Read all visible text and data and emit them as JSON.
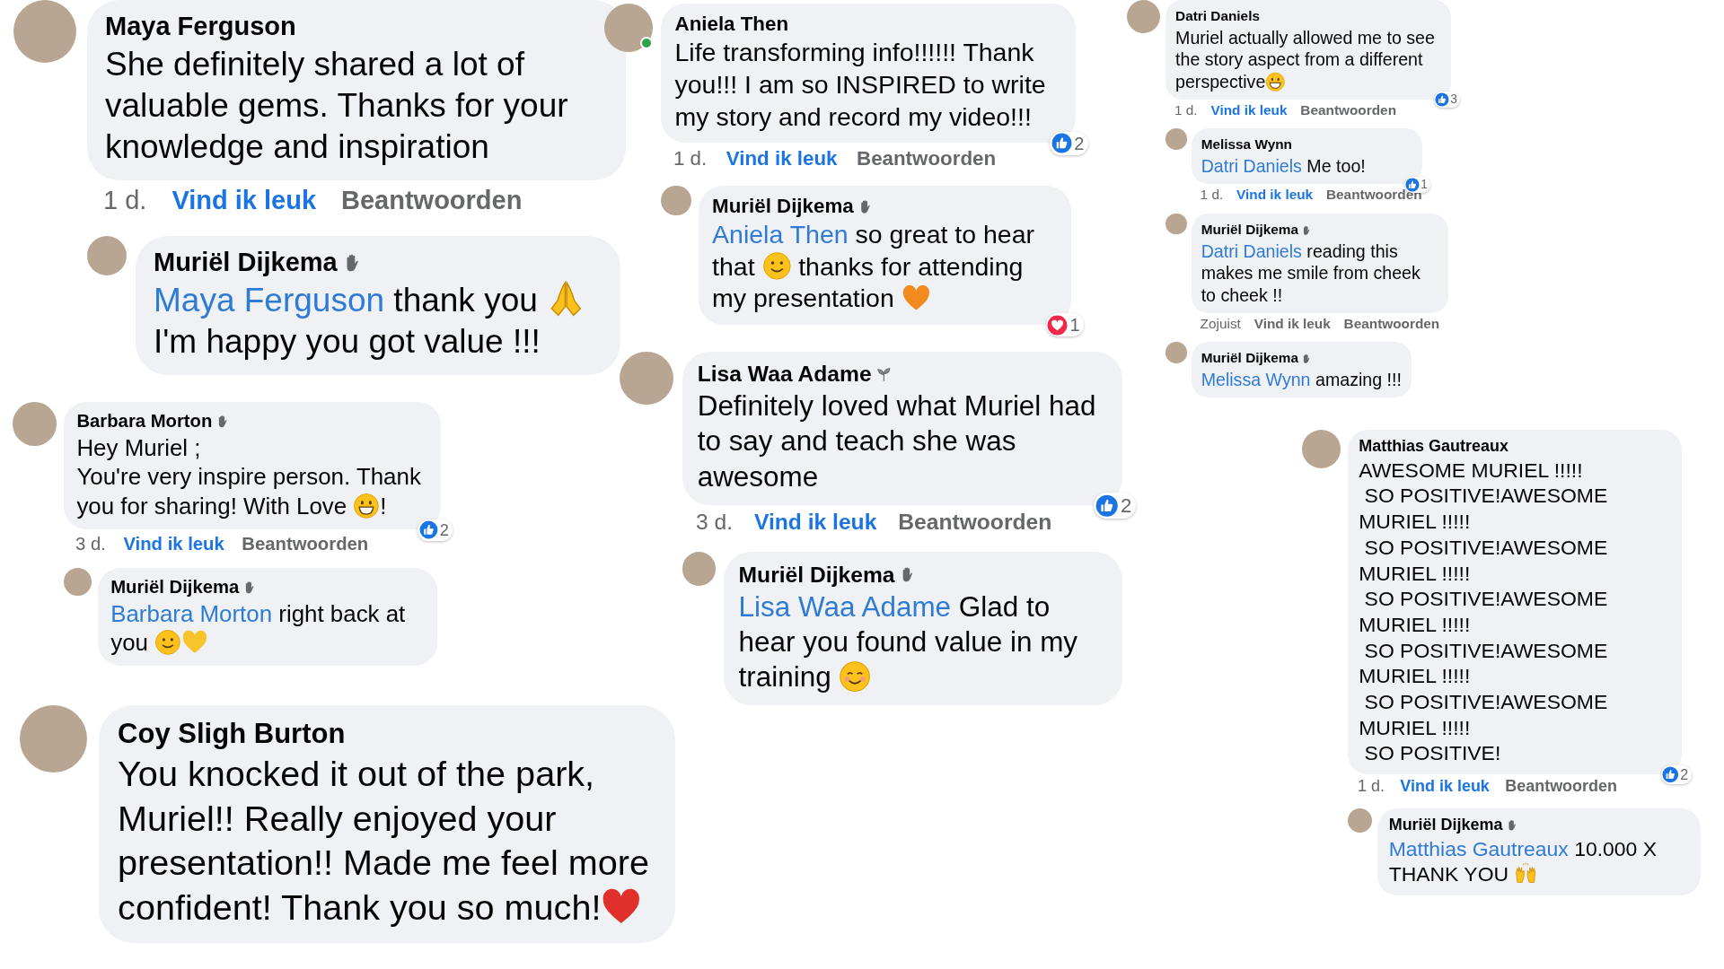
{
  "panels": [
    {
      "comments": [
        {
          "author": "Maya Ferguson",
          "body": [
            {
              "kind": "text",
              "text": "She definitely shared a lot of valuable gems. Thanks for your knowledge and inspiration"
            }
          ],
          "time": "1 d.",
          "like_label": "Vind ik leuk",
          "liked": true,
          "reply_label": "Beantwoorden",
          "replies": [
            {
              "author": "Muriël Dijkema",
              "author_badge": {
                "kind": "wave"
              },
              "body": [
                {
                  "kind": "mention",
                  "text": "Maya Ferguson"
                },
                {
                  "kind": "text",
                  "text": " thank you "
                },
                {
                  "kind": "pray"
                },
                {
                  "kind": "text",
                  "text": " I'm happy you got value !!!"
                }
              ]
            }
          ]
        },
        {
          "author": "Barbara Morton",
          "author_badge": {
            "kind": "wave"
          },
          "body": [
            {
              "kind": "text",
              "text": "Hey Muriel ;\nYou're very inspire person. Thank you for sharing! With Love "
            },
            {
              "kind": "grin"
            },
            {
              "kind": "text",
              "text": "!"
            }
          ],
          "time": "3 d.",
          "like_label": "Vind ik leuk",
          "liked": true,
          "reply_label": "Beantwoorden",
          "reaction": {
            "kind": "like",
            "count": "2"
          },
          "replies": [
            {
              "author": "Muriël Dijkema",
              "author_badge": {
                "kind": "wave"
              },
              "body": [
                {
                  "kind": "mention",
                  "text": "Barbara Morton"
                },
                {
                  "kind": "text",
                  "text": " right back at you "
                },
                {
                  "kind": "smile"
                },
                {
                  "kind": "heart",
                  "color": "#f7c42b"
                }
              ]
            }
          ]
        },
        {
          "author": "Coy Sligh Burton",
          "body": [
            {
              "kind": "text",
              "text": "You knocked it out of the park, Muriel!! Really enjoyed your presentation!! Made me feel more confident! Thank you so much!"
            },
            {
              "kind": "heart",
              "color": "#e0302c"
            }
          ]
        }
      ]
    },
    {
      "comments": [
        {
          "author": "Aniela Then",
          "online": true,
          "body": [
            {
              "kind": "text",
              "text": "Life transforming info!!!!!! Thank you!!! I am so INSPIRED to write my story and record my video!!!"
            }
          ],
          "time": "1 d.",
          "like_label": "Vind ik leuk",
          "liked": true,
          "reply_label": "Beantwoorden",
          "reaction": {
            "kind": "like",
            "count": "2"
          },
          "replies": [
            {
              "author": "Muriël Dijkema",
              "author_badge": {
                "kind": "wave"
              },
              "body": [
                {
                  "kind": "mention",
                  "text": "Aniela Then"
                },
                {
                  "kind": "text",
                  "text": " so great to hear that "
                },
                {
                  "kind": "smile"
                },
                {
                  "kind": "text",
                  "text": " thanks for attending my presentation "
                },
                {
                  "kind": "heart",
                  "color": "#f28a1e"
                }
              ],
              "reaction": {
                "kind": "love",
                "count": "1"
              }
            }
          ]
        },
        {
          "author": "Lisa Waa Adame",
          "author_badge": {
            "kind": "sprout"
          },
          "body": [
            {
              "kind": "text",
              "text": "Definitely loved what Muriel had to say and teach she was awesome"
            }
          ],
          "time": "3 d.",
          "like_label": "Vind ik leuk",
          "liked": true,
          "reply_label": "Beantwoorden",
          "reaction": {
            "kind": "like",
            "count": "2"
          },
          "replies": [
            {
              "author": "Muriël Dijkema",
              "author_badge": {
                "kind": "wave"
              },
              "body": [
                {
                  "kind": "mention",
                  "text": "Lisa Waa Adame"
                },
                {
                  "kind": "text",
                  "text": " Glad to hear you found value in my training "
                },
                {
                  "kind": "blush"
                }
              ]
            }
          ]
        }
      ]
    },
    {
      "comments": [
        {
          "author": "Datri Daniels",
          "body": [
            {
              "kind": "text",
              "text": "Muriel actually allowed me to see the story aspect from a different perspective"
            },
            {
              "kind": "grin"
            }
          ],
          "time": "1 d.",
          "like_label": "Vind ik leuk",
          "liked": true,
          "reply_label": "Beantwoorden",
          "reaction": {
            "kind": "like",
            "count": "3"
          },
          "replies": [
            {
              "author": "Melissa Wynn",
              "body": [
                {
                  "kind": "mention",
                  "text": "Datri Daniels"
                },
                {
                  "kind": "text",
                  "text": " Me too!"
                }
              ],
              "reaction": {
                "kind": "like",
                "count": "1"
              },
              "time": "1 d.",
              "like_label": "Vind ik leuk",
              "liked": true,
              "reply_label": "Beantwoorden"
            },
            {
              "author": "Muriël Dijkema",
              "author_badge": {
                "kind": "wave"
              },
              "body": [
                {
                  "kind": "mention",
                  "text": "Datri Daniels"
                },
                {
                  "kind": "text",
                  "text": " reading this makes me smile from cheek to cheek !!"
                }
              ],
              "time": "Zojuist",
              "like_label": "Vind ik leuk",
              "liked": false,
              "reply_label": "Beantwoorden"
            },
            {
              "author": "Muriël Dijkema",
              "author_badge": {
                "kind": "wave"
              },
              "body": [
                {
                  "kind": "mention",
                  "text": "Melissa Wynn"
                },
                {
                  "kind": "text",
                  "text": " amazing !!!"
                }
              ]
            }
          ]
        },
        {
          "author": "Matthias Gautreaux",
          "body": [
            {
              "kind": "text",
              "text": "AWESOME MURIEL !!!!!\n SO POSITIVE!AWESOME MURIEL !!!!!\n SO POSITIVE!AWESOME MURIEL !!!!!\n SO POSITIVE!AWESOME MURIEL !!!!!\n SO POSITIVE!AWESOME MURIEL !!!!!\n SO POSITIVE!AWESOME MURIEL !!!!!\n SO POSITIVE!"
            }
          ],
          "time": "1 d.",
          "like_label": "Vind ik leuk",
          "liked": true,
          "reply_label": "Beantwoorden",
          "reaction": {
            "kind": "like",
            "count": "2"
          },
          "replies": [
            {
              "author": "Muriël Dijkema",
              "author_badge": {
                "kind": "wave"
              },
              "body": [
                {
                  "kind": "mention",
                  "text": "Matthias Gautreaux"
                },
                {
                  "kind": "text",
                  "text": " 10.000 X THANK YOU "
                },
                {
                  "kind": "raised-hands"
                }
              ]
            }
          ]
        }
      ]
    }
  ]
}
